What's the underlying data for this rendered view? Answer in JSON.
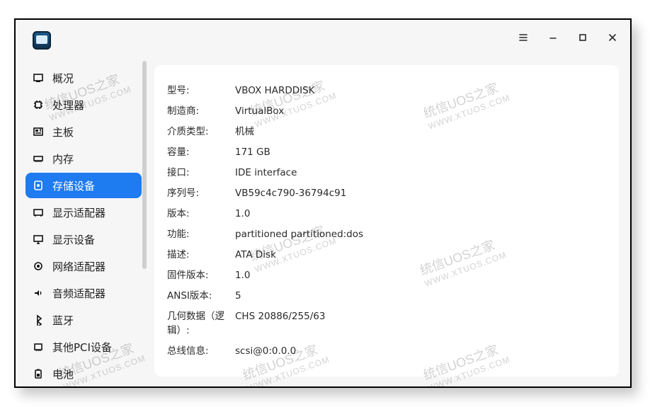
{
  "window": {
    "app_icon": "device-manager-app-icon",
    "controls": {
      "menu": "menu-icon",
      "minimize": "minimize-icon",
      "maximize": "maximize-icon",
      "close": "close-icon"
    },
    "accent": "#1e7bf0"
  },
  "sidebar": {
    "items": [
      {
        "label": "概况",
        "icon": "overview-icon",
        "active": false
      },
      {
        "label": "处理器",
        "icon": "cpu-icon",
        "active": false
      },
      {
        "label": "主板",
        "icon": "motherboard-icon",
        "active": false
      },
      {
        "label": "内存",
        "icon": "memory-icon",
        "active": false
      },
      {
        "label": "存储设备",
        "icon": "storage-icon",
        "active": true
      },
      {
        "label": "显示适配器",
        "icon": "display-adapter-icon",
        "active": false
      },
      {
        "label": "显示设备",
        "icon": "monitor-icon",
        "active": false
      },
      {
        "label": "网络适配器",
        "icon": "network-icon",
        "active": false
      },
      {
        "label": "音频适配器",
        "icon": "audio-icon",
        "active": false
      },
      {
        "label": "蓝牙",
        "icon": "bluetooth-icon",
        "active": false
      },
      {
        "label": "其他PCI设备",
        "icon": "pci-icon",
        "active": false
      },
      {
        "label": "电池",
        "icon": "battery-icon",
        "active": false
      }
    ]
  },
  "details": {
    "rows": [
      {
        "key": "型号:",
        "value": "VBOX HARDDISK"
      },
      {
        "key": "制造商:",
        "value": "VirtualBox"
      },
      {
        "key": "介质类型:",
        "value": "机械"
      },
      {
        "key": "容量:",
        "value": "171 GB"
      },
      {
        "key": "接口:",
        "value": "IDE interface"
      },
      {
        "key": "序列号:",
        "value": "VB59c4c790-36794c91"
      },
      {
        "key": "版本:",
        "value": "1.0"
      },
      {
        "key": "功能:",
        "value": "partitioned partitioned:dos"
      },
      {
        "key": "描述:",
        "value": "ATA Disk"
      },
      {
        "key": "固件版本:",
        "value": "1.0"
      },
      {
        "key": "ANSI版本:",
        "value": "5"
      },
      {
        "key": "几何数据（逻辑）:",
        "value": "CHS 20886/255/63"
      },
      {
        "key": "总线信息:",
        "value": "scsi@0:0.0.0"
      }
    ]
  },
  "watermark": {
    "line1": "统信UOS之家",
    "line2": "WWW.XTUOS.COM"
  }
}
